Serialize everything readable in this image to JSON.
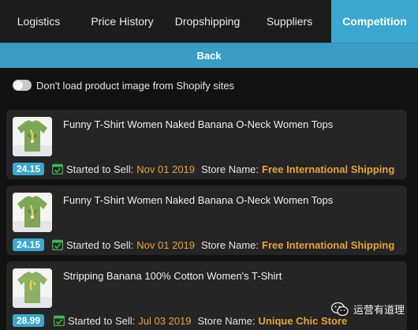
{
  "tabs": [
    {
      "label": "Logistics",
      "active": false
    },
    {
      "label": "Price History",
      "active": false
    },
    {
      "label": "Dropshipping",
      "active": false
    },
    {
      "label": "Suppliers",
      "active": false
    },
    {
      "label": "Competition",
      "active": true
    }
  ],
  "back_label": "Back",
  "toggle": {
    "label": "Don't load product image from Shopify sites",
    "on": false
  },
  "products": [
    {
      "title": "Funny T-Shirt Women Naked Banana O-Neck Women Tops",
      "price": "24.15",
      "started_label": "Started to Sell:",
      "date": "Nov 01 2019",
      "store_label": "Store Name:",
      "store": "Free International Shipping",
      "thumb_icon": "green-tshirt-banana-thumbnail"
    },
    {
      "title": "Funny T-Shirt Women Naked Banana O-Neck Women Tops",
      "price": "24.15",
      "started_label": "Started to Sell:",
      "date": "Nov 01 2019",
      "store_label": "Store Name:",
      "store": "Free International Shipping",
      "thumb_icon": "green-tshirt-banana-thumbnail"
    },
    {
      "title": "Stripping Banana 100% Cotton Women's T-Shirt",
      "price": "28.99",
      "started_label": "Started to Sell:",
      "date": "Jul 03 2019",
      "store_label": "Store Name:",
      "store": "Unique Chic Store",
      "thumb_icon": "green-tshirt-banana-thumbnail"
    }
  ],
  "watermark": {
    "text": "运营有道理",
    "icon": "wechat-icon"
  },
  "colors": {
    "accent": "#3aa7d0",
    "highlight": "#e8a23a",
    "background": "#121212",
    "card": "#252525"
  }
}
